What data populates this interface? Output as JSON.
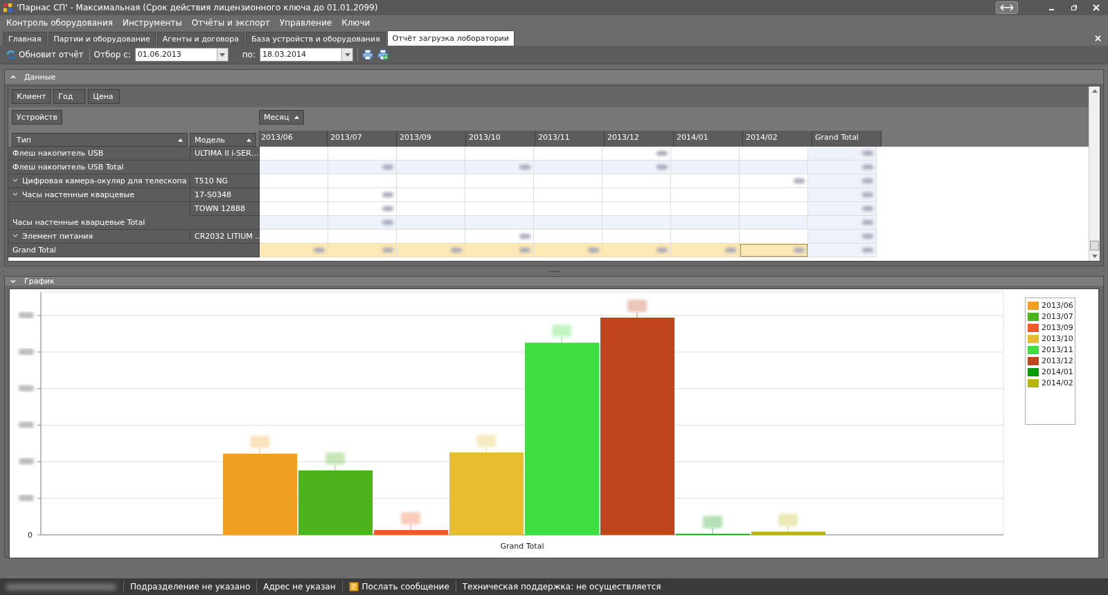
{
  "window": {
    "title": "'Парнас СП' - Максимальная (Срок действия лицензионного ключа до 01.01.2099)"
  },
  "menu": [
    "Контроль оборудования",
    "Инструменты",
    "Отчёты и экспорт",
    "Управление",
    "Ключи"
  ],
  "tabs": [
    {
      "label": "Главная",
      "selected": false
    },
    {
      "label": "Партии и оборудование",
      "selected": false
    },
    {
      "label": "Агенты и договора",
      "selected": false
    },
    {
      "label": "База устройств и оборудования",
      "selected": false
    },
    {
      "label": "Отчёт загрузка лоборатории",
      "selected": true
    }
  ],
  "toolbar": {
    "refresh": "Обновит отчёт",
    "from_label": "Отбор с:",
    "from_value": "01.06.2013",
    "to_label": "по:",
    "to_value": "18.03.2014"
  },
  "data_panel": {
    "title": "Данные",
    "expanded": true,
    "filter_fields": [
      "Клиент",
      "Год",
      "Цена"
    ],
    "row_field": "Устройств",
    "column_field": "Месяц",
    "row_headers": [
      "Тип",
      "Модель"
    ],
    "columns": [
      "2013/06",
      "2013/07",
      "2013/09",
      "2013/10",
      "2013/11",
      "2013/12",
      "2014/01",
      "2014/02",
      "Grand Total"
    ],
    "rows": [
      {
        "kind": "item",
        "type": "Флеш накопитель USB",
        "model": "ULTIMA II i-SER…",
        "expandable": false,
        "cells": [
          {
            "blurred": false,
            "focused": false
          },
          {
            "blurred": false,
            "focused": false
          },
          {
            "blurred": false,
            "focused": false
          },
          {
            "blurred": false,
            "focused": false
          },
          {
            "blurred": false,
            "focused": false
          },
          {
            "blurred": true,
            "focused": false
          },
          {
            "blurred": false,
            "focused": false
          },
          {
            "blurred": false,
            "focused": false
          },
          {
            "blurred": true,
            "focused": false
          }
        ]
      },
      {
        "kind": "total",
        "type": "Флеш накопитель USB Total",
        "cells": [
          {
            "blurred": false,
            "focused": false
          },
          {
            "blurred": true,
            "focused": false
          },
          {
            "blurred": false,
            "focused": false
          },
          {
            "blurred": true,
            "focused": false
          },
          {
            "blurred": false,
            "focused": false
          },
          {
            "blurred": true,
            "focused": false
          },
          {
            "blurred": false,
            "focused": false
          },
          {
            "blurred": false,
            "focused": false
          },
          {
            "blurred": true,
            "focused": false
          }
        ]
      },
      {
        "kind": "item",
        "type": "Цифровая камера-окуляр для телескопа",
        "model": "T510 NG",
        "expandable": true,
        "cells": [
          {
            "blurred": false,
            "focused": false
          },
          {
            "blurred": false,
            "focused": false
          },
          {
            "blurred": false,
            "focused": false
          },
          {
            "blurred": false,
            "focused": false
          },
          {
            "blurred": false,
            "focused": false
          },
          {
            "blurred": false,
            "focused": false
          },
          {
            "blurred": false,
            "focused": false
          },
          {
            "blurred": true,
            "focused": false
          },
          {
            "blurred": true,
            "focused": false
          }
        ]
      },
      {
        "kind": "item",
        "type": "Часы настенные кварцевые",
        "model": "17-S0348",
        "expandable": true,
        "cells": [
          {
            "blurred": false,
            "focused": false
          },
          {
            "blurred": true,
            "focused": false
          },
          {
            "blurred": false,
            "focused": false
          },
          {
            "blurred": false,
            "focused": false
          },
          {
            "blurred": false,
            "focused": false
          },
          {
            "blurred": false,
            "focused": false
          },
          {
            "blurred": false,
            "focused": false
          },
          {
            "blurred": false,
            "focused": false
          },
          {
            "blurred": true,
            "focused": false
          }
        ]
      },
      {
        "kind": "sub",
        "model": "TOWN 12888",
        "cells": [
          {
            "blurred": false,
            "focused": false
          },
          {
            "blurred": true,
            "focused": false
          },
          {
            "blurred": false,
            "focused": false
          },
          {
            "blurred": false,
            "focused": false
          },
          {
            "blurred": false,
            "focused": false
          },
          {
            "blurred": false,
            "focused": false
          },
          {
            "blurred": false,
            "focused": false
          },
          {
            "blurred": false,
            "focused": false
          },
          {
            "blurred": true,
            "focused": false
          }
        ]
      },
      {
        "kind": "total",
        "type": "Часы настенные кварцевые Total",
        "cells": [
          {
            "blurred": false,
            "focused": false
          },
          {
            "blurred": true,
            "focused": false
          },
          {
            "blurred": false,
            "focused": false
          },
          {
            "blurred": false,
            "focused": false
          },
          {
            "blurred": false,
            "focused": false
          },
          {
            "blurred": false,
            "focused": false
          },
          {
            "blurred": false,
            "focused": false
          },
          {
            "blurred": false,
            "focused": false
          },
          {
            "blurred": true,
            "focused": false
          }
        ]
      },
      {
        "kind": "item",
        "type": "Элемент питания",
        "model": "CR2032 LITIUM …",
        "expandable": true,
        "cells": [
          {
            "blurred": false,
            "focused": false
          },
          {
            "blurred": false,
            "focused": false
          },
          {
            "blurred": false,
            "focused": false
          },
          {
            "blurred": true,
            "focused": false
          },
          {
            "blurred": false,
            "focused": false
          },
          {
            "blurred": false,
            "focused": false
          },
          {
            "blurred": false,
            "focused": false
          },
          {
            "blurred": false,
            "focused": false
          },
          {
            "blurred": true,
            "focused": false
          }
        ]
      },
      {
        "kind": "grand",
        "type": "Grand Total",
        "cells": [
          {
            "blurred": true,
            "focused": false
          },
          {
            "blurred": true,
            "focused": false
          },
          {
            "blurred": true,
            "focused": false
          },
          {
            "blurred": true,
            "focused": false
          },
          {
            "blurred": true,
            "focused": false
          },
          {
            "blurred": true,
            "focused": false
          },
          {
            "blurred": true,
            "focused": false
          },
          {
            "blurred": true,
            "focused": true
          },
          {
            "blurred": true,
            "focused": false
          }
        ]
      }
    ]
  },
  "chart_panel": {
    "title": "График",
    "expanded": false,
    "zero_label": "0",
    "x_label": "Grand Total",
    "series": [
      {
        "name": "2013/06",
        "color": "#f0a020",
        "level": 0.34
      },
      {
        "name": "2013/07",
        "color": "#4cb31a",
        "level": 0.27
      },
      {
        "name": "2013/09",
        "color": "#f05a28",
        "level": 0.02
      },
      {
        "name": "2013/10",
        "color": "#e8be30",
        "level": 0.345
      },
      {
        "name": "2013/11",
        "color": "#3de040",
        "level": 0.805
      },
      {
        "name": "2013/12",
        "color": "#c0441c",
        "level": 0.91
      },
      {
        "name": "2014/01",
        "color": "#0a9a0a",
        "level": 0.004
      },
      {
        "name": "2014/02",
        "color": "#b8b40a",
        "level": 0.013
      }
    ]
  },
  "status_bar": [
    {
      "kind": "text",
      "text": "Подразделение не указано"
    },
    {
      "kind": "text",
      "text": "Адрес не указан"
    },
    {
      "kind": "message",
      "text": "Послать сообщение"
    },
    {
      "kind": "text",
      "text": "Техническая поддержка: не осуществляется"
    }
  ]
}
